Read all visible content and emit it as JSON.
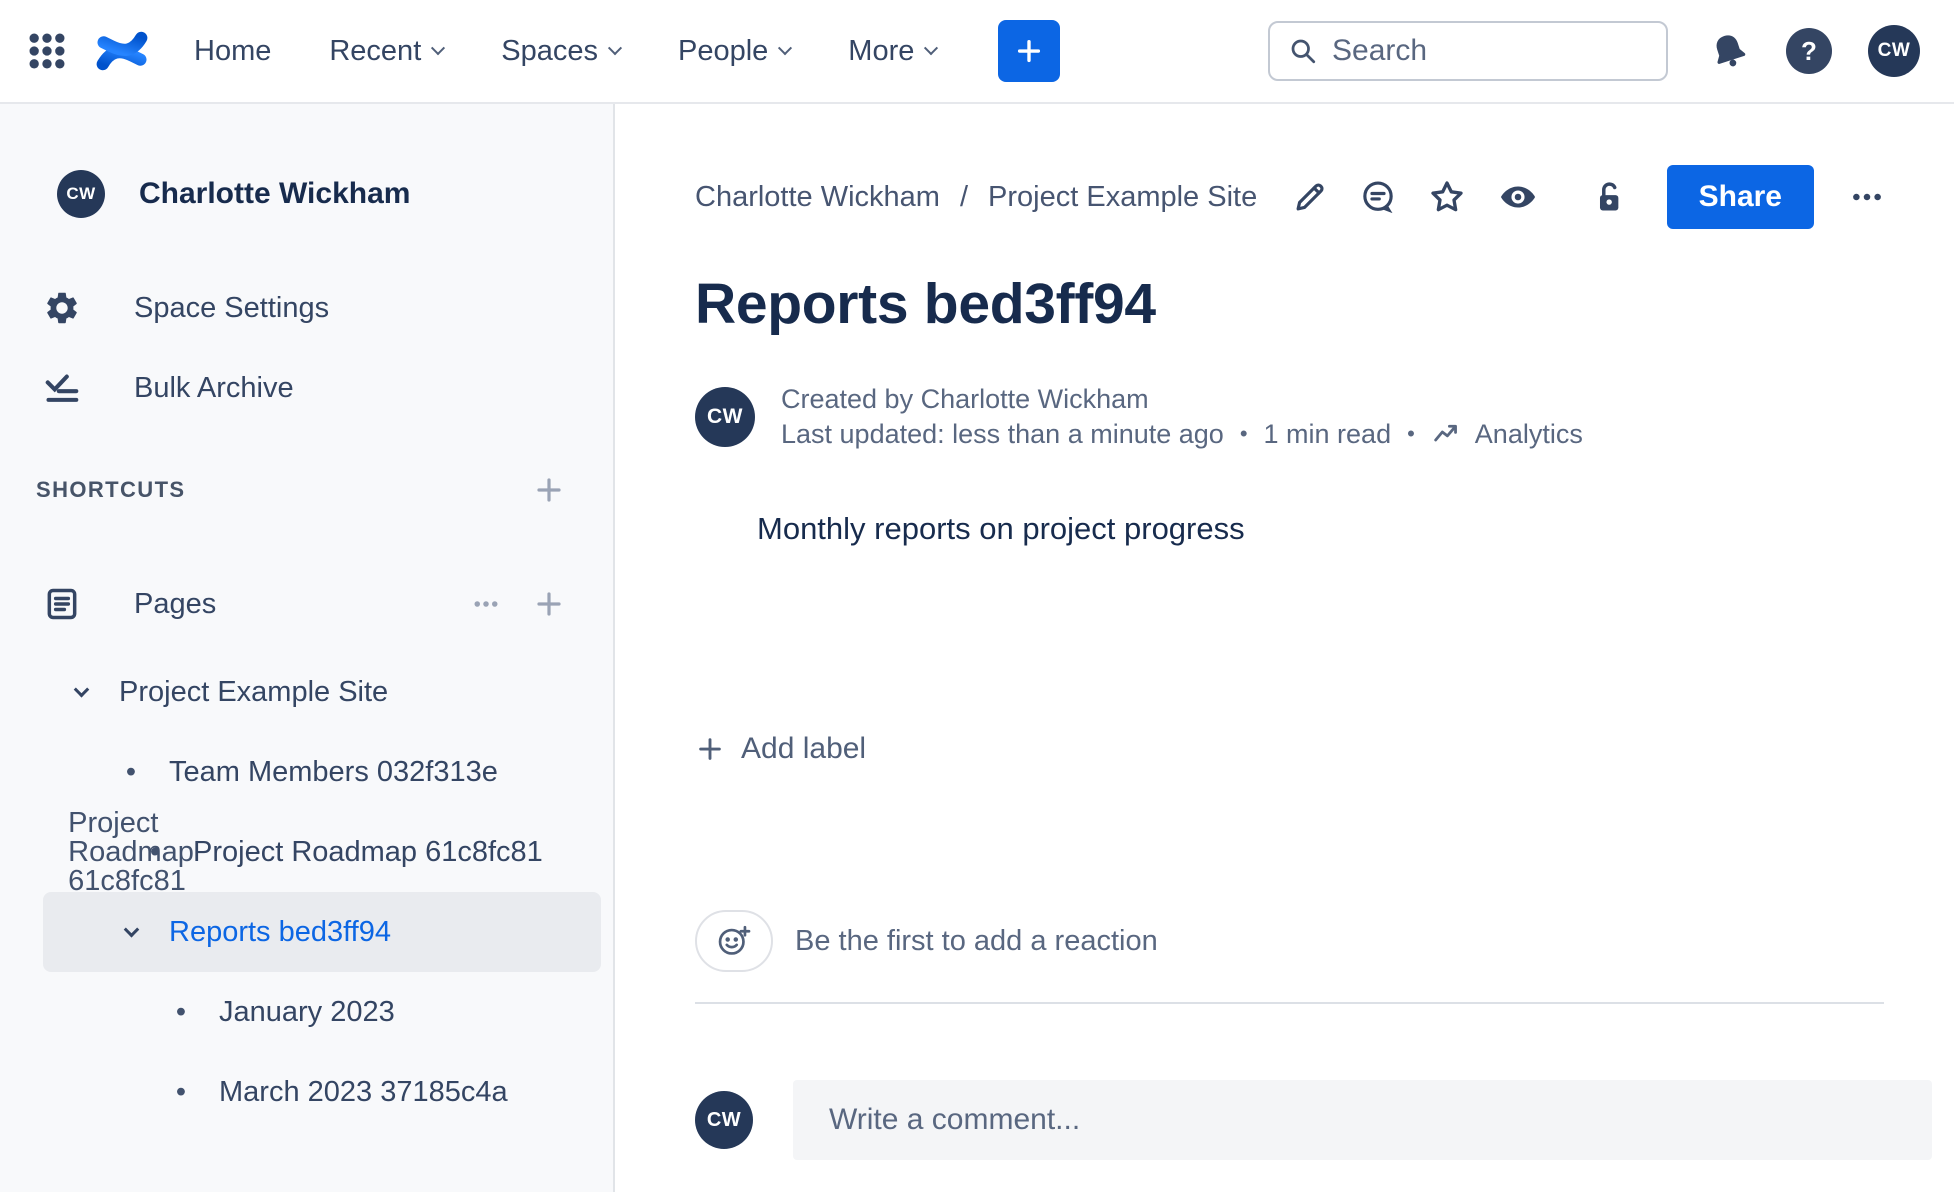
{
  "topnav": {
    "items": [
      {
        "label": "Home",
        "has_dropdown": false
      },
      {
        "label": "Recent",
        "has_dropdown": true
      },
      {
        "label": "Spaces",
        "has_dropdown": true
      },
      {
        "label": "People",
        "has_dropdown": true
      },
      {
        "label": "More",
        "has_dropdown": true
      }
    ],
    "search_placeholder": "Search",
    "help_glyph": "?",
    "avatar_initials": "CW"
  },
  "sidebar": {
    "space_name": "Charlotte Wickham",
    "avatar_initials": "CW",
    "menu": [
      {
        "icon": "gear-icon",
        "label": "Space Settings"
      },
      {
        "icon": "bulk-archive-icon",
        "label": "Bulk Archive"
      }
    ],
    "shortcuts_header": "SHORTCUTS",
    "pages_header": "Pages",
    "bullet_glyph": "•",
    "tree": [
      {
        "label": "Project Example Site",
        "level": 1,
        "marker": "chevron",
        "selected": false
      },
      {
        "label": "Team Members 032f313e",
        "level": 2,
        "marker": "bullet",
        "selected": false
      },
      {
        "label": "Project Roadmap 61c8fc81",
        "level": 2,
        "marker": "bullet",
        "selected": false
      },
      {
        "label": "Reports bed3ff94",
        "level": 2,
        "marker": "chevron",
        "selected": true
      },
      {
        "label": "January 2023",
        "level": 3,
        "marker": "bullet",
        "selected": false
      },
      {
        "label": "March 2023 37185c4a",
        "level": 3,
        "marker": "bullet",
        "selected": false
      }
    ]
  },
  "main": {
    "breadcrumb": {
      "items": [
        "Charlotte Wickham",
        "Project Example Site"
      ],
      "separator": "/"
    },
    "actions": {
      "share_label": "Share"
    },
    "title": "Reports bed3ff94",
    "byline": {
      "avatar_initials": "CW",
      "created": "Created by Charlotte Wickham",
      "updated": "Last updated: less than a minute ago",
      "read_time": "1 min read",
      "dot": "•",
      "analytics_label": "Analytics"
    },
    "body_text": "Monthly reports on project progress",
    "add_label_text": "Add label",
    "reaction_text": "Be the first to add a reaction",
    "comment": {
      "avatar_initials": "CW",
      "placeholder": "Write a comment..."
    }
  },
  "colors": {
    "primary_blue": "#0C66E4",
    "heading_navy": "#172B4D",
    "nav_text": "#344563",
    "meta_gray": "#596780",
    "sidebar_bg": "#F8F9FB",
    "selected_row_bg": "#E9EBEF",
    "avatar_bg": "#253858",
    "border_gray": "#DFE1E6",
    "comment_input_bg": "#F4F5F7"
  }
}
